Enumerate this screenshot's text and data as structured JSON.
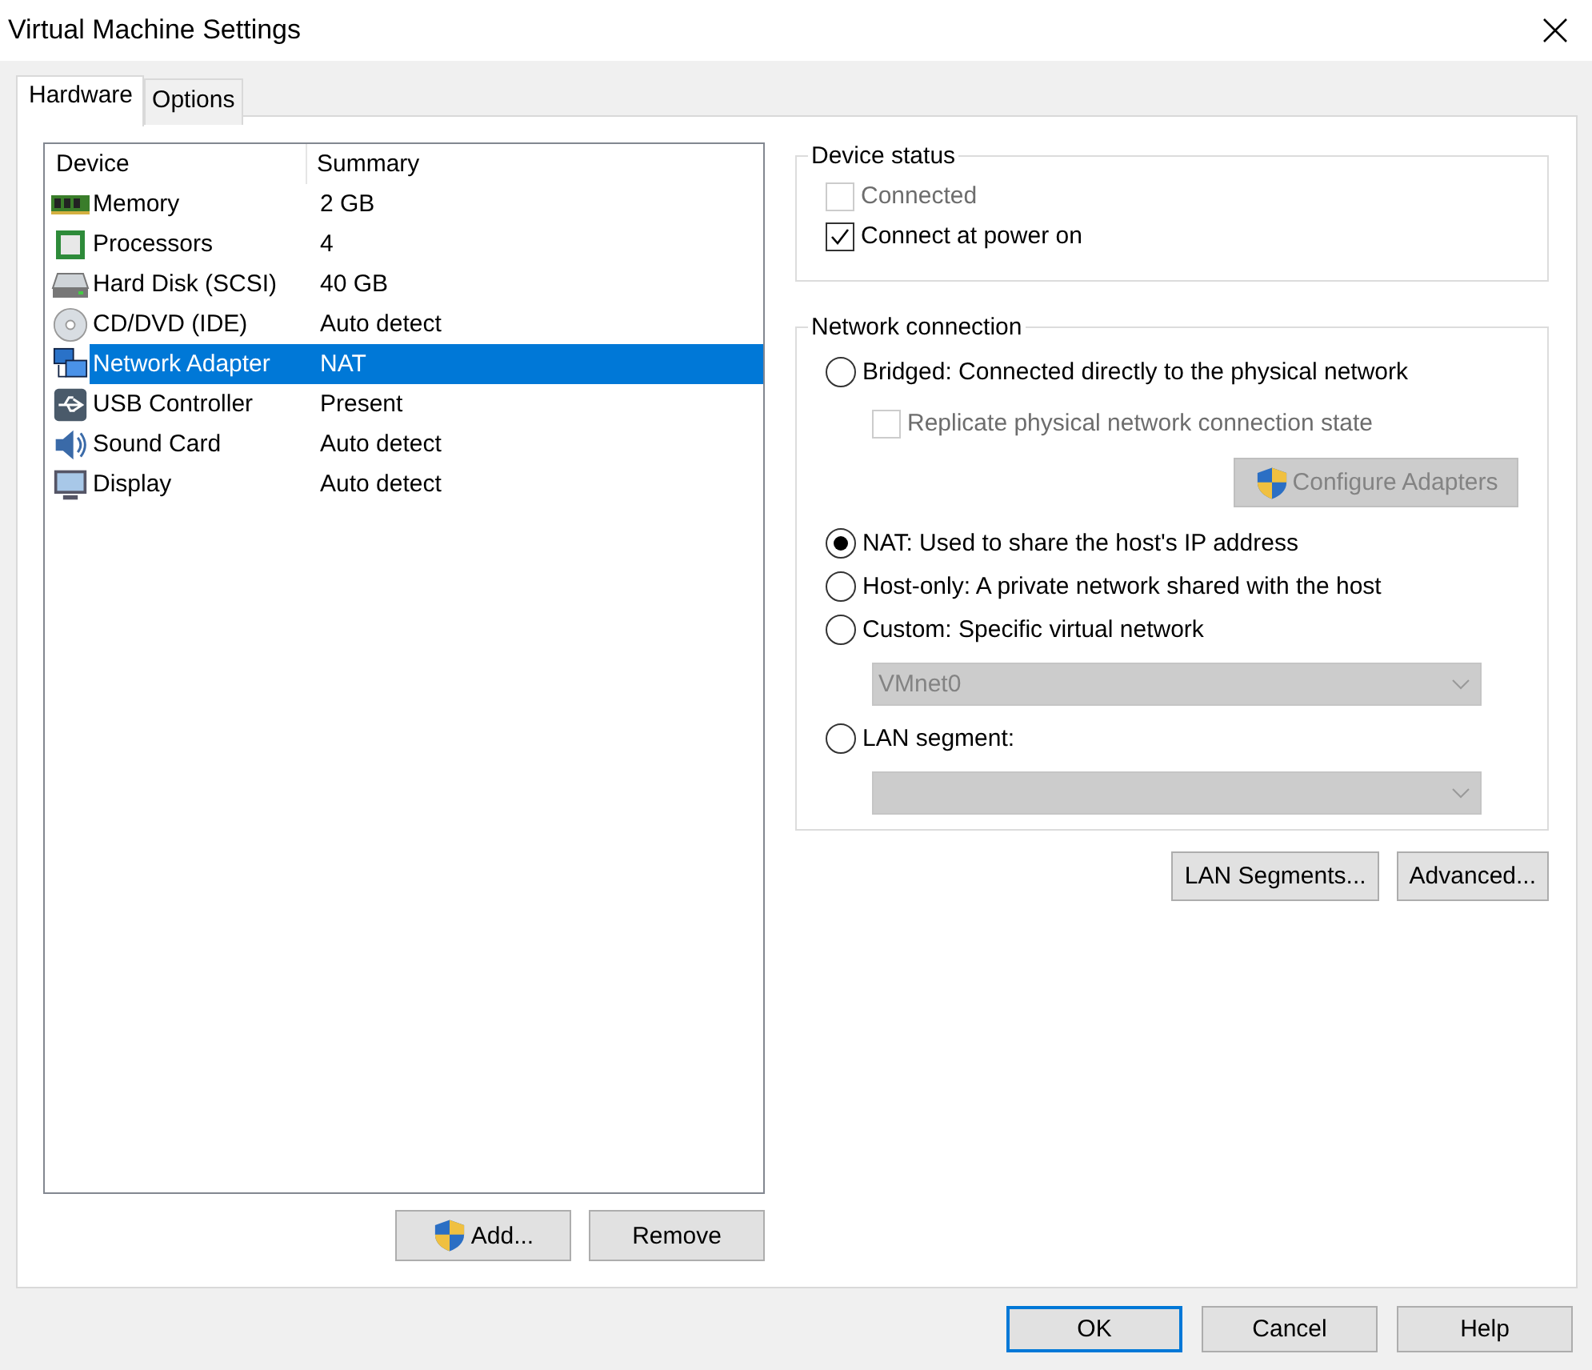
{
  "window": {
    "title": "Virtual Machine Settings"
  },
  "tabs": [
    {
      "label": "Hardware",
      "selected": true
    },
    {
      "label": "Options",
      "selected": false
    }
  ],
  "device_list": {
    "columns": [
      "Device",
      "Summary"
    ],
    "rows": [
      {
        "kind": "memory",
        "device": "Memory",
        "summary": "2 GB",
        "selected": false
      },
      {
        "kind": "processor",
        "device": "Processors",
        "summary": "4",
        "selected": false
      },
      {
        "kind": "disk",
        "device": "Hard Disk (SCSI)",
        "summary": "40 GB",
        "selected": false
      },
      {
        "kind": "cd",
        "device": "CD/DVD (IDE)",
        "summary": "Auto detect",
        "selected": false
      },
      {
        "kind": "network",
        "device": "Network Adapter",
        "summary": "NAT",
        "selected": true
      },
      {
        "kind": "usb",
        "device": "USB Controller",
        "summary": "Present",
        "selected": false
      },
      {
        "kind": "sound",
        "device": "Sound Card",
        "summary": "Auto detect",
        "selected": false
      },
      {
        "kind": "display",
        "device": "Display",
        "summary": "Auto detect",
        "selected": false
      }
    ]
  },
  "list_buttons": [
    {
      "label": "Add...",
      "shield": true
    },
    {
      "label": "Remove",
      "shield": false
    }
  ],
  "device_status": {
    "title": "Device status",
    "checkboxes": [
      {
        "label": "Connected",
        "checked": false,
        "disabled": true
      },
      {
        "label": "Connect at power on",
        "checked": true,
        "disabled": false
      }
    ]
  },
  "network_connection": {
    "title": "Network connection",
    "items": [
      {
        "kind": "radio",
        "label": "Bridged: Connected directly to the physical network",
        "selected": false
      },
      {
        "kind": "checkbox",
        "label": "Replicate physical network connection state",
        "checked": false,
        "disabled": true
      },
      {
        "kind": "button",
        "label": "Configure Adapters",
        "disabled": true
      },
      {
        "kind": "radio",
        "label": "NAT: Used to share the host's IP address",
        "selected": true
      },
      {
        "kind": "radio",
        "label": "Host-only: A private network shared with the host",
        "selected": false
      },
      {
        "kind": "radio",
        "label": "Custom: Specific virtual network",
        "selected": false
      },
      {
        "kind": "dropdown",
        "value": "VMnet0",
        "disabled": true
      },
      {
        "kind": "radio",
        "label": "LAN segment:",
        "selected": false
      },
      {
        "kind": "dropdown",
        "disabled": true
      }
    ]
  },
  "network_buttons": [
    "LAN Segments...",
    "Advanced..."
  ],
  "dialog_buttons": [
    {
      "label": "OK",
      "default": true
    },
    {
      "label": "Cancel",
      "default": false
    },
    {
      "label": "Help",
      "default": false
    }
  ]
}
